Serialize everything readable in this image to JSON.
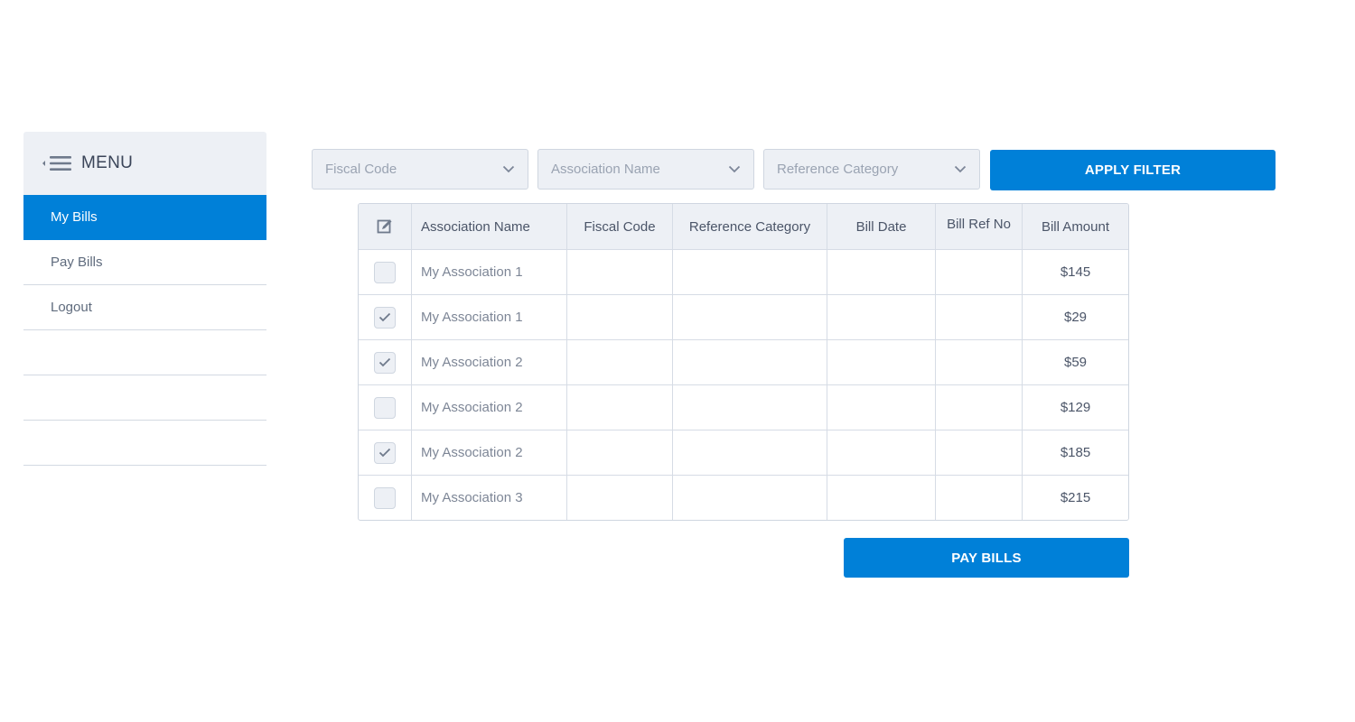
{
  "sidebar": {
    "menu_title": "MENU",
    "items": [
      {
        "label": "My Bills",
        "active": true
      },
      {
        "label": "Pay Bills",
        "active": false
      },
      {
        "label": "Logout",
        "active": false
      },
      {
        "label": "",
        "active": false
      },
      {
        "label": "",
        "active": false
      },
      {
        "label": "",
        "active": false
      }
    ]
  },
  "filters": {
    "fiscal_code": {
      "placeholder": "Fiscal Code"
    },
    "association_name": {
      "placeholder": "Association Name"
    },
    "reference_category": {
      "placeholder": "Reference Category"
    },
    "apply_label": "APPLY FILTER"
  },
  "table": {
    "columns": [
      "Association Name",
      "Fiscal Code",
      "Reference Category",
      "Bill Date",
      "Bill Ref No",
      "Bill Amount"
    ],
    "rows": [
      {
        "checked": false,
        "association": "My Association 1",
        "fiscal_code": "",
        "reference_category": "",
        "bill_date": "",
        "bill_ref_no": "",
        "amount": "$145"
      },
      {
        "checked": true,
        "association": "My Association 1",
        "fiscal_code": "",
        "reference_category": "",
        "bill_date": "",
        "bill_ref_no": "",
        "amount": "$29"
      },
      {
        "checked": true,
        "association": "My Association 2",
        "fiscal_code": "",
        "reference_category": "",
        "bill_date": "",
        "bill_ref_no": "",
        "amount": "$59"
      },
      {
        "checked": false,
        "association": "My Association 2",
        "fiscal_code": "",
        "reference_category": "",
        "bill_date": "",
        "bill_ref_no": "",
        "amount": "$129"
      },
      {
        "checked": true,
        "association": "My Association 2",
        "fiscal_code": "",
        "reference_category": "",
        "bill_date": "",
        "bill_ref_no": "",
        "amount": "$185"
      },
      {
        "checked": false,
        "association": "My Association 3",
        "fiscal_code": "",
        "reference_category": "",
        "bill_date": "",
        "bill_ref_no": "",
        "amount": "$215"
      }
    ]
  },
  "pay_label": "PAY BILLS",
  "icons": {
    "menu": "menu-collapse-icon",
    "dropdown": "chevron-down-icon",
    "select_all": "edit-checkbox-icon",
    "check": "checkmark-icon"
  },
  "colors": {
    "accent": "#0080d8",
    "panel": "#edf0f5",
    "border": "#cfd6e0"
  }
}
